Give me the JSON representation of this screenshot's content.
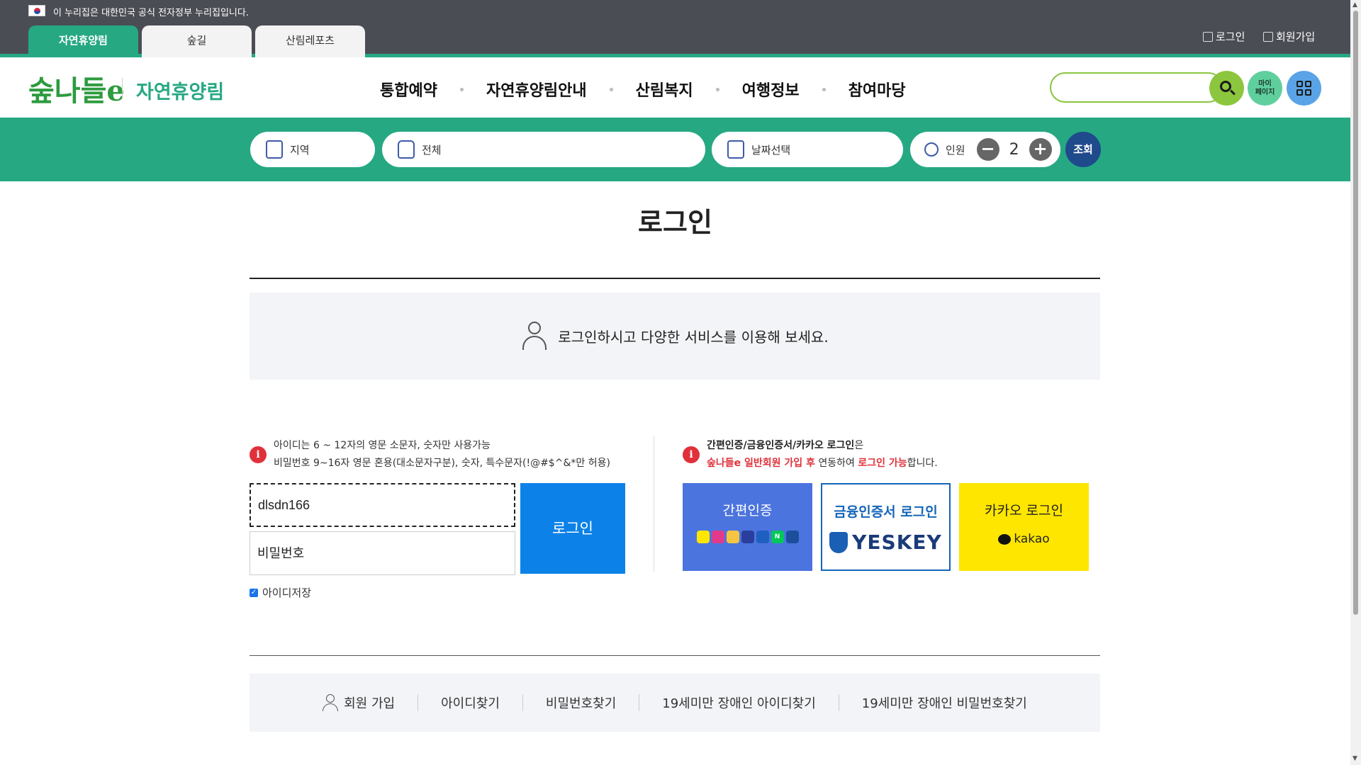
{
  "gov_banner": {
    "text": "이 누리집은 대한민국 공식 전자정부 누리집입니다."
  },
  "site_tabs": [
    {
      "label": "자연휴양림",
      "active": true
    },
    {
      "label": "숲길",
      "active": false
    },
    {
      "label": "산림레포츠",
      "active": false
    }
  ],
  "top_links": {
    "login": "로그인",
    "signup": "회원가입"
  },
  "header": {
    "logo_text": "숲나들e",
    "site_name": "자연휴양림",
    "nav": [
      "통합예약",
      "자연휴양림안내",
      "산림복지",
      "여행정보",
      "참여마당"
    ],
    "search_placeholder": "",
    "mypage_label": "마이\n페이지",
    "search_icon": "search-icon",
    "menu_icon": "grid-menu-icon"
  },
  "filter": {
    "region": "지역",
    "forest": "전체",
    "date": "날짜선택",
    "people_label": "인원",
    "people_count": "2",
    "minus": "−",
    "plus": "+",
    "search_label": "조회"
  },
  "main": {
    "title": "로그인",
    "intro": "로그인하시고 다양한 서비스를 이용해 보세요."
  },
  "login_form": {
    "info_line1": "아이디는 6 ~ 12자의 영문 소문자, 숫자만 사용가능",
    "info_line2": "비밀번호 9~16자 영문 혼용(대소문자구분), 숫자, 특수문자(!@#$^&*만 허용)",
    "id_value": "dlsdn166",
    "pw_placeholder": "비밀번호",
    "login_button": "로그인",
    "remember_label": "아이디저장",
    "remember_checked": true
  },
  "alt_login": {
    "info_bold": "간편인증/금융인증서/카카오 로그인",
    "info_after_bold": "은",
    "info_red1": "숲나들e 일반회원 가입 후",
    "info_mid": " 연동하여 ",
    "info_red2": "로그인 가능",
    "info_end": "합니다.",
    "simple_label": "간편인증",
    "cert_label": "금융인증서 로그인",
    "cert_brand": "YESKEY",
    "kakao_label": "카카오 로그인",
    "kakao_brand": "kakao",
    "colors": {
      "simple": "#4c74de",
      "cert_border": "#1565b8",
      "kakao": "#ffe600"
    }
  },
  "bottom_links": [
    "회원 가입",
    "아이디찾기",
    "비밀번호찾기",
    "19세미만 장애인 아이디찾기",
    "19세미만 장애인 비밀번호찾기"
  ],
  "colors": {
    "brand_green": "#26a883",
    "dark_bar": "#4b4d55",
    "login_blue": "#0c82e8",
    "alert_red": "#e0313b"
  }
}
